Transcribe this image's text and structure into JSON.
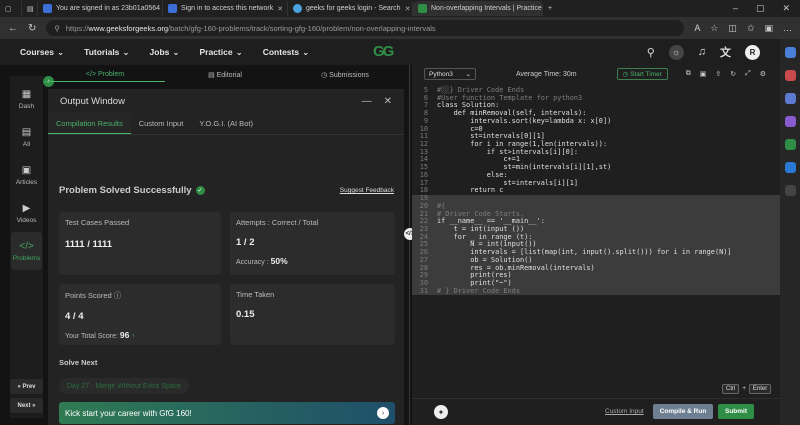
{
  "browser": {
    "tabs": [
      {
        "title": "You are signed in as 23b01a0564",
        "color": "#3a6fd8"
      },
      {
        "title": "Sign in to access this network",
        "color": "#3a6fd8"
      },
      {
        "title": "geeks for geeks login - Search",
        "color": "#4aa3df"
      },
      {
        "title": "Non-overlapping Intervals | Practice",
        "color": "#2f8d46"
      }
    ],
    "new_tab": "+",
    "url_host": "www.geeksforgeeks.org",
    "url_path": "/batch/gfg-160-problems/track/sorting-gfg-160/problem/non-overlapping-intervals",
    "url_scheme": "https://"
  },
  "site_nav": {
    "items": [
      "Courses",
      "Tutorials",
      "Jobs",
      "Practice",
      "Contests"
    ],
    "logo": "GG",
    "avatar": "R"
  },
  "left_nav": {
    "items": [
      {
        "label": "Dash",
        "icon": "▦"
      },
      {
        "label": "All",
        "icon": "▤"
      },
      {
        "label": "Articles",
        "icon": "▣"
      },
      {
        "label": "Videos",
        "icon": "▶"
      },
      {
        "label": "Problems",
        "icon": "</>"
      }
    ],
    "prev": "« Prev",
    "next": "Next »"
  },
  "problem_tabs": [
    {
      "label": "</> Problem"
    },
    {
      "label": "▤ Editorial"
    },
    {
      "label": "◷ Submissions"
    }
  ],
  "output": {
    "title": "Output Window",
    "tabs": [
      "Compilation Results",
      "Custom Input",
      "Y.O.G.I. (AI Bot)"
    ],
    "status": "Problem Solved Successfully",
    "feedback": "Suggest Feedback",
    "test_cases_label": "Test Cases Passed",
    "test_cases_value": "1111 / 1111",
    "attempts_label": "Attempts : Correct / Total",
    "attempts_value": "1 / 2",
    "accuracy_label": "Accuracy :",
    "accuracy_value": "50%",
    "points_label": "Points Scored",
    "points_value": "4 / 4",
    "total_label": "Your Total Score:",
    "total_value": "96",
    "time_label": "Time Taken",
    "time_value": "0.15",
    "solve_next": "Solve Next",
    "next_problem": "Day 27 - Merge Without Extra Space",
    "banner": "Kick start your career with GfG 160!"
  },
  "editor": {
    "language": "Python3",
    "avg_time": "Average Time: 30m",
    "timer": "Start Timer",
    "lines": [
      {
        "n": "5",
        "t": "#░░} Driver Code Ends",
        "hl": false
      },
      {
        "n": "6",
        "t": "#User function Template for python3",
        "hl": false
      },
      {
        "n": "7",
        "t": "class Solution:",
        "hl": false
      },
      {
        "n": "8",
        "t": "    def minRemoval(self, intervals):",
        "hl": false
      },
      {
        "n": "9",
        "t": "        intervals.sort(key=lambda x: x[0])",
        "hl": false
      },
      {
        "n": "10",
        "t": "        c=0",
        "hl": false
      },
      {
        "n": "11",
        "t": "        st=intervals[0][1]",
        "hl": false
      },
      {
        "n": "12",
        "t": "        for i in range(1,len(intervals)):",
        "hl": false
      },
      {
        "n": "13",
        "t": "            if st>intervals[i][0]:",
        "hl": false
      },
      {
        "n": "14",
        "t": "                c+=1",
        "hl": false
      },
      {
        "n": "15",
        "t": "                st=min(intervals[i][1],st)",
        "hl": false
      },
      {
        "n": "16",
        "t": "            else:",
        "hl": false
      },
      {
        "n": "17",
        "t": "                st=intervals[i][1]",
        "hl": false
      },
      {
        "n": "18",
        "t": "        return c",
        "hl": false
      },
      {
        "n": "19",
        "t": "",
        "hl": true
      },
      {
        "n": "20",
        "t": "#{",
        "hl": true
      },
      {
        "n": "21",
        "t": "# Driver Code Starts.",
        "hl": true
      },
      {
        "n": "22",
        "t": "if __name__ == '__main__':",
        "hl": true
      },
      {
        "n": "23",
        "t": "    t = int(input ())",
        "hl": true
      },
      {
        "n": "24",
        "t": "    for _ in range (t):",
        "hl": true
      },
      {
        "n": "25",
        "t": "        N = int(input())",
        "hl": true
      },
      {
        "n": "26",
        "t": "        intervals = [list(map(int, input().split())) for i in range(N)]",
        "hl": true
      },
      {
        "n": "27",
        "t": "        ob = Solution()",
        "hl": true
      },
      {
        "n": "28",
        "t": "        res = ob.minRemoval(intervals)",
        "hl": true
      },
      {
        "n": "29",
        "t": "        print(res)",
        "hl": true
      },
      {
        "n": "30",
        "t": "        print(\"~\")",
        "hl": true
      },
      {
        "n": "31",
        "t": "# } Driver Code Ends",
        "hl": true
      }
    ],
    "kbd_ctrl": "Ctrl",
    "kbd_plus": "+",
    "kbd_enter": "Enter",
    "custom_input": "Custom Input",
    "compile": "Compile & Run",
    "submit": "Submit"
  }
}
